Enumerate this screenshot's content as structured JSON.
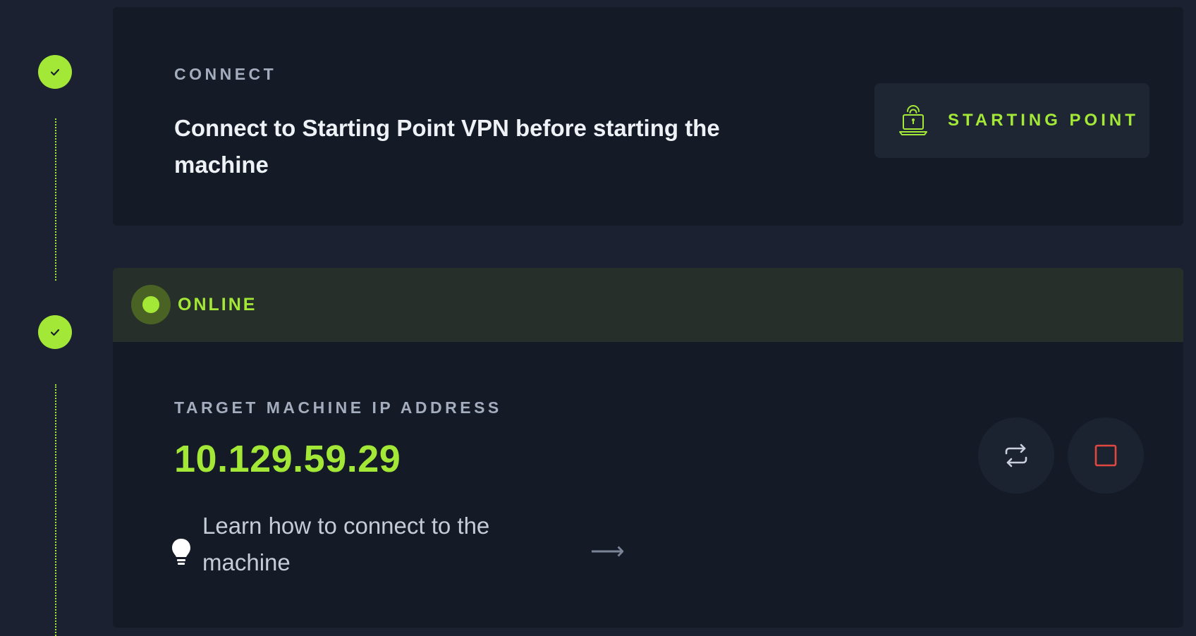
{
  "steps": [
    {
      "status": "completed",
      "icon": "check-icon"
    },
    {
      "status": "completed",
      "icon": "check-icon"
    }
  ],
  "connect": {
    "eyebrow": "CONNECT",
    "description": "Connect to Starting Point VPN before starting the machine",
    "button_label": "STARTING POINT",
    "button_icon": "vpn-laptop-icon"
  },
  "machine": {
    "status_label": "ONLINE",
    "ip_eyebrow": "TARGET MACHINE IP ADDRESS",
    "ip_address": "10.129.59.29",
    "learn_link": "Learn how to connect to the machine",
    "learn_icon": "lightbulb-icon",
    "arrow": "⟶",
    "actions": [
      {
        "name": "reset-machine-button",
        "icon": "reset-arrows-icon"
      },
      {
        "name": "stop-machine-button",
        "icon": "stop-square-icon"
      }
    ]
  },
  "colors": {
    "accent": "#a4e837",
    "background": "#1b2130",
    "card": "#141b27",
    "online_band": "#262f29",
    "stop": "#e0473e"
  }
}
